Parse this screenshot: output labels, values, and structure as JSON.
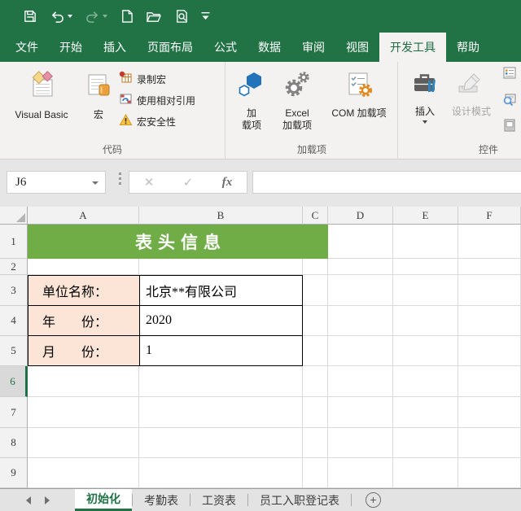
{
  "colors": {
    "brand_green": "#217346",
    "title_fill": "#70AD47",
    "label_fill": "#FCE4D6",
    "active_text": "#217346"
  },
  "ribbon_tabs": {
    "items": [
      "文件",
      "开始",
      "插入",
      "页面布局",
      "公式",
      "数据",
      "审阅",
      "视图",
      "开发工具",
      "帮助"
    ],
    "active": "开发工具"
  },
  "ribbon": {
    "code_group": {
      "label": "代码",
      "visual_basic": "Visual Basic",
      "macro": "宏",
      "record_macro": "录制宏",
      "use_relative_references": "使用相对引用",
      "macro_security": "宏安全性"
    },
    "addins_group": {
      "label": "加载项",
      "addins_line1": "加",
      "addins_line2": "载项",
      "excel_addins_line1": "Excel",
      "excel_addins_line2": "加载项",
      "com_addins": "COM 加载项"
    },
    "controls_group": {
      "label": "控件",
      "insert": "插入",
      "design_mode": "设计模式"
    }
  },
  "formula_bar": {
    "name_box": "J6",
    "cancel": "✕",
    "enter": "✓",
    "insert_function": "fx"
  },
  "sheet": {
    "column_headers": [
      "A",
      "B",
      "C",
      "D",
      "E",
      "F"
    ],
    "row_headers": [
      "1",
      "2",
      "3",
      "4",
      "5",
      "6",
      "7",
      "8",
      "9"
    ],
    "selected_row": "6",
    "selected_cell": "J6",
    "title": "表头信息",
    "fields": [
      {
        "label": "单位名称：",
        "value": "北京**有限公司"
      },
      {
        "label": "年　　份：",
        "value": "2020"
      },
      {
        "label": "月　　份：",
        "value": "1"
      }
    ]
  },
  "sheet_tabs": {
    "active": "初始化",
    "items": [
      "初始化",
      "考勤表",
      "工资表",
      "员工入职登记表"
    ],
    "new_sheet": "+"
  }
}
